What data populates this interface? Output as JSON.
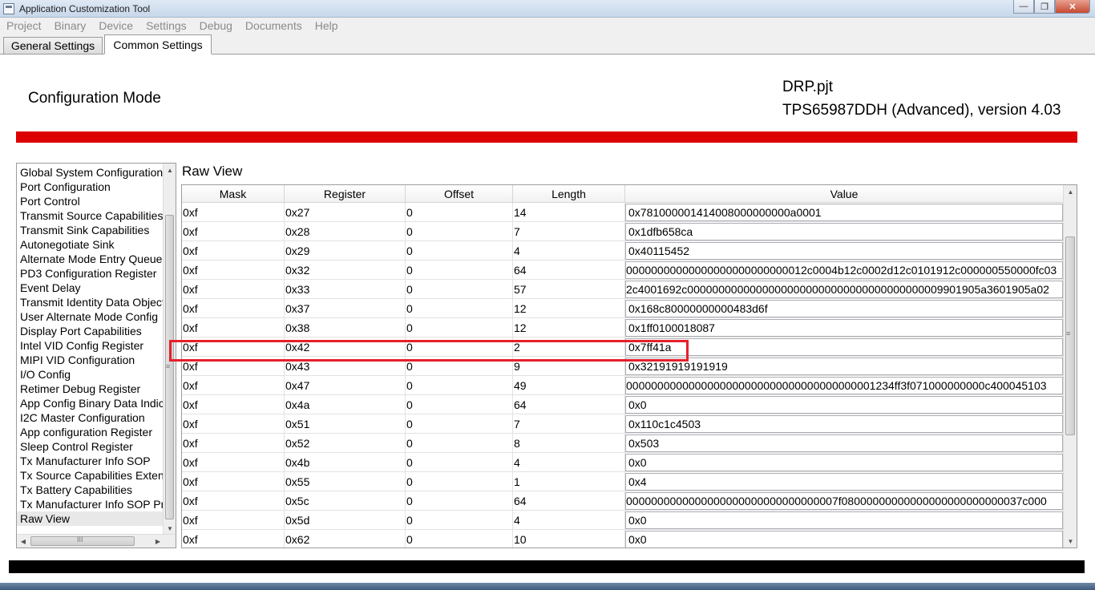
{
  "window": {
    "title": "Application Customization Tool"
  },
  "menu": [
    "Project",
    "Binary",
    "Device",
    "Settings",
    "Debug",
    "Documents",
    "Help"
  ],
  "tabs": [
    {
      "label": "General Settings",
      "active": false
    },
    {
      "label": "Common Settings",
      "active": true
    }
  ],
  "header": {
    "mode": "Configuration Mode",
    "project_file": "DRP.pjt",
    "device": "TPS65987DDH (Advanced), version 4.03"
  },
  "nav": {
    "items": [
      "Global System Configuration",
      "Port Configuration",
      "Port Control",
      "Transmit Source Capabilities",
      "Transmit Sink Capabilities",
      "Autonegotiate Sink",
      "Alternate Mode Entry Queue",
      "PD3 Configuration Register",
      "Event Delay",
      "Transmit Identity Data Object",
      "User Alternate Mode Config",
      "Display Port Capabilities",
      "Intel VID Config Register",
      "MIPI VID Configuration",
      "I/O Config",
      "Retimer Debug Register",
      "App Config Binary Data Indices",
      "I2C Master Configuration",
      "App configuration Register",
      "Sleep Control Register",
      "Tx Manufacturer Info SOP",
      "Tx Source Capabilities Extended",
      "Tx Battery Capabilities",
      "Tx Manufacturer Info SOP Prime",
      "Raw View"
    ],
    "selected": "Raw View",
    "hscroll_grip": "III"
  },
  "raw_view": {
    "title": "Raw View",
    "columns": [
      "Mask",
      "Register",
      "Offset",
      "Length",
      "Value"
    ],
    "rows": [
      [
        "0xf",
        "0x27",
        "0",
        "14",
        "0x781000001414008000000000a0001"
      ],
      [
        "0xf",
        "0x28",
        "0",
        "7",
        "0x1dfb658ca"
      ],
      [
        "0xf",
        "0x29",
        "0",
        "4",
        "0x40115452"
      ],
      [
        "0xf",
        "0x32",
        "0",
        "64",
        "00000000000000000000000000012c0004b12c0002d12c0101912c000000550000fc03"
      ],
      [
        "0xf",
        "0x33",
        "0",
        "57",
        "2c4001692c00000000000000000000000000000000000000009901905a3601905a02"
      ],
      [
        "0xf",
        "0x37",
        "0",
        "12",
        "0x168c80000000000483d6f"
      ],
      [
        "0xf",
        "0x38",
        "0",
        "12",
        "0x1ff0100018087"
      ],
      [
        "0xf",
        "0x42",
        "0",
        "2",
        "0x7ff41a"
      ],
      [
        "0xf",
        "0x43",
        "0",
        "9",
        "0x32191919191919"
      ],
      [
        "0xf",
        "0x47",
        "0",
        "49",
        "0000000000000000000000000000000000000001234ff3f071000000000c400045103"
      ],
      [
        "0xf",
        "0x4a",
        "0",
        "64",
        "0x0"
      ],
      [
        "0xf",
        "0x51",
        "0",
        "7",
        "0x110c1c4503"
      ],
      [
        "0xf",
        "0x52",
        "0",
        "8",
        "0x503"
      ],
      [
        "0xf",
        "0x4b",
        "0",
        "4",
        "0x0"
      ],
      [
        "0xf",
        "0x55",
        "0",
        "1",
        "0x4"
      ],
      [
        "0xf",
        "0x5c",
        "0",
        "64",
        "0000000000000000000000000000000007f08000000000000000000000000037c000"
      ],
      [
        "0xf",
        "0x5d",
        "0",
        "4",
        "0x0"
      ],
      [
        "0xf",
        "0x62",
        "0",
        "10",
        "0x0"
      ]
    ],
    "overflow_rows": [
      3,
      4,
      9,
      15
    ],
    "highlighted_register": "0x42"
  },
  "icons": {
    "scroll_up": "▲",
    "scroll_down": "▼",
    "scroll_left": "◀",
    "scroll_right": "▶",
    "vgrip": "≡"
  },
  "colors": {
    "accent_bar": "#dd0000",
    "highlight_box": "#e5202a",
    "status_bar": "#000000"
  },
  "window_buttons": {
    "minimize": "—",
    "restore": "❐",
    "close": "✕"
  }
}
